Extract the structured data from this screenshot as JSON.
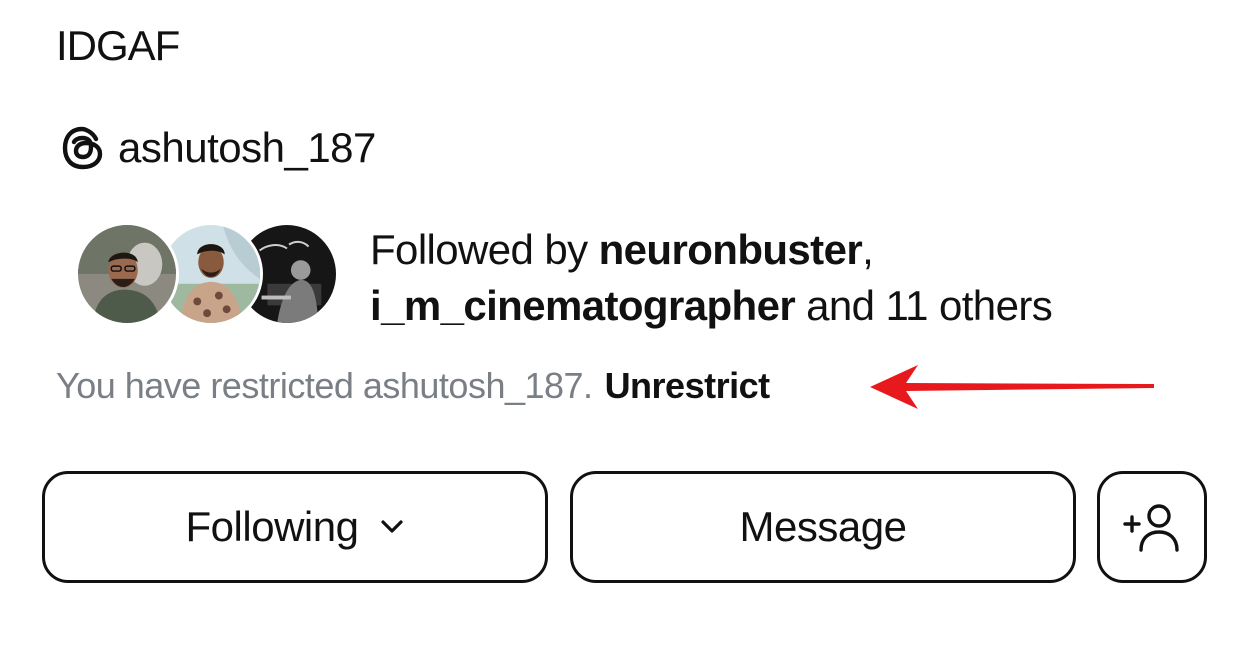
{
  "profile": {
    "bio": "IDGAF",
    "threads_handle": "ashutosh_187",
    "threads_icon": "threads-icon"
  },
  "followed_by": {
    "prefix": "Followed by ",
    "user1": "neuronbuster",
    "separator": ",",
    "user2": "i_m_cinematographer",
    "middle": " and ",
    "others": "11 others",
    "avatars": [
      "avatar-neuronbuster",
      "avatar-i-m-cinematographer",
      "avatar-third-follower"
    ]
  },
  "restriction": {
    "message": "You have restricted ashutosh_187.",
    "action": "Unrestrict"
  },
  "annotation": {
    "arrow_color": "#e8191c",
    "arrow_icon": "arrow-left-icon"
  },
  "actions": {
    "following_label": "Following",
    "following_icon": "chevron-down-icon",
    "message_label": "Message",
    "add_user_icon": "add-user-icon"
  }
}
